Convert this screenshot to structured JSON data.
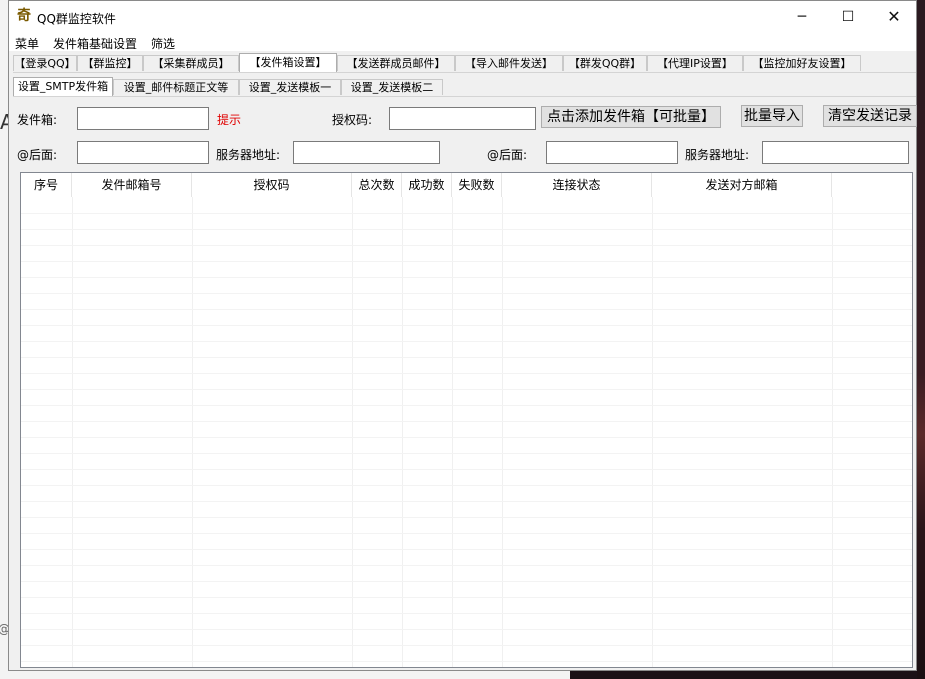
{
  "window": {
    "title": "QQ群监控软件",
    "app_icon": "奇"
  },
  "background": {
    "peek_a": "A",
    "peek_b": "@"
  },
  "menubar": [
    "菜单",
    "发件箱基础设置",
    "筛选"
  ],
  "main_tabs": [
    {
      "label": "【登录QQ】",
      "active": false
    },
    {
      "label": "【群监控】",
      "active": false
    },
    {
      "label": "【采集群成员】",
      "active": false
    },
    {
      "label": "【发件箱设置】",
      "active": true
    },
    {
      "label": "【发送群成员邮件】",
      "active": false
    },
    {
      "label": "【导入邮件发送】",
      "active": false
    },
    {
      "label": "【群发QQ群】",
      "active": false
    },
    {
      "label": "【代理IP设置】",
      "active": false
    },
    {
      "label": "【监控加好友设置】",
      "active": false
    }
  ],
  "sub_tabs": [
    {
      "label": "设置_SMTP发件箱",
      "active": true
    },
    {
      "label": "设置_邮件标题正文等",
      "active": false
    },
    {
      "label": "设置_发送模板一",
      "active": false
    },
    {
      "label": "设置_发送模板二",
      "active": false
    }
  ],
  "form": {
    "sender_label": "发件箱:",
    "sender_value": "",
    "hint": "提示",
    "auth_label": "授权码:",
    "auth_value": "",
    "add_button": "点击添加发件箱【可批量】",
    "import_button": "批量导入",
    "clear_button": "清空发送记录",
    "suffix1_label": "@后面:",
    "suffix1_value": "",
    "server1_label": "服务器地址:",
    "server1_value": "",
    "suffix2_label": "@后面:",
    "suffix2_value": "",
    "server2_label": "服务器地址:",
    "server2_value": ""
  },
  "table": {
    "columns": [
      "序号",
      "发件邮箱号",
      "授权码",
      "总次数",
      "成功数",
      "失败数",
      "连接状态",
      "发送对方邮箱"
    ],
    "rows": []
  }
}
